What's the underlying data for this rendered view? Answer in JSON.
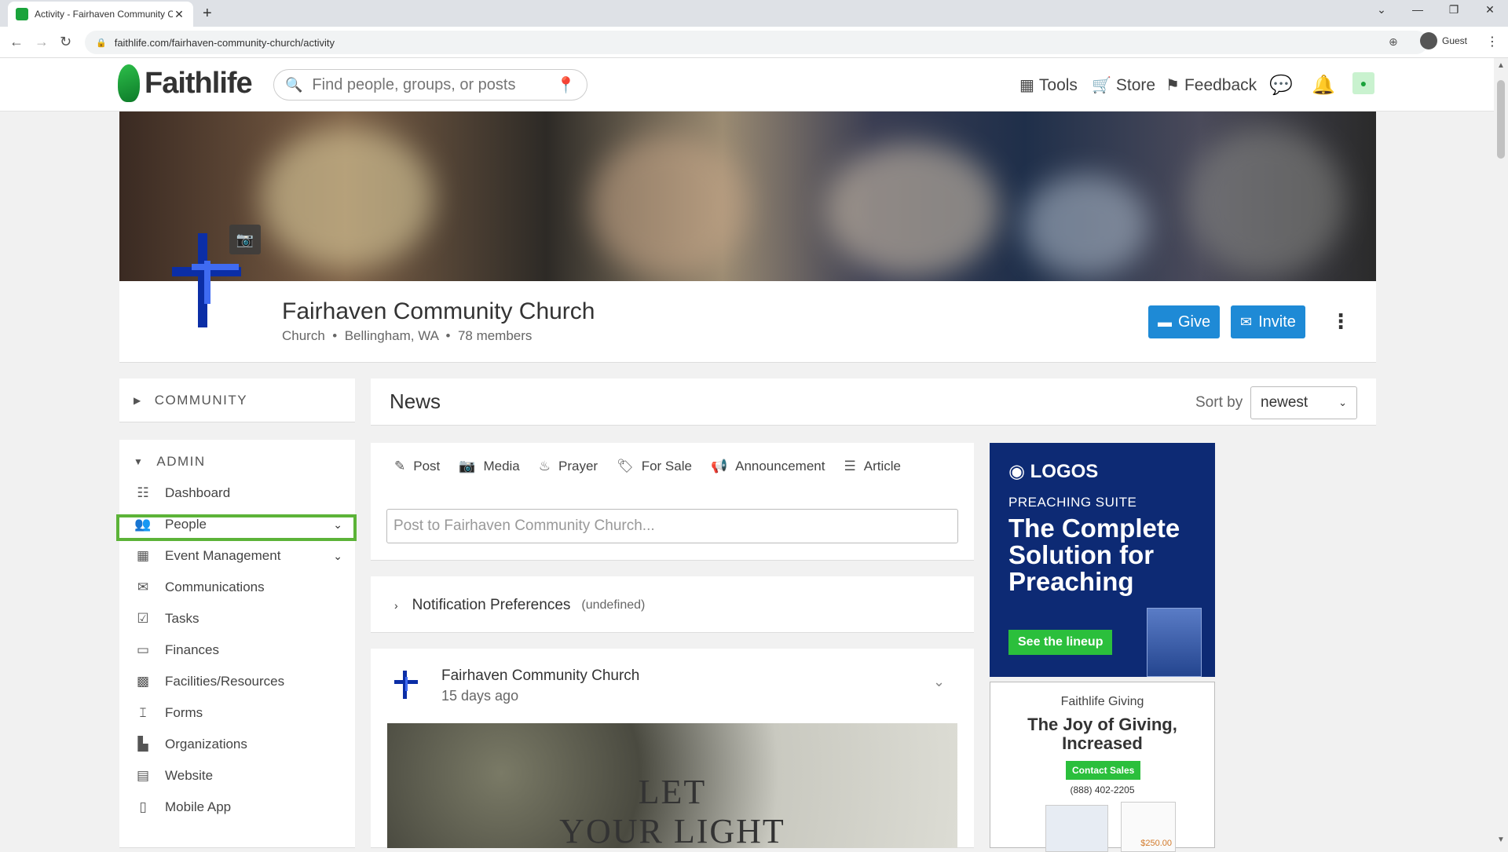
{
  "browser": {
    "tab_title": "Activity - Fairhaven Community C",
    "url": "faithlife.com/fairhaven-community-church/activity",
    "profile": "Guest"
  },
  "header": {
    "logo": "Faithlife",
    "search_placeholder": "Find people, groups, or posts",
    "nav": [
      {
        "label": "Tools",
        "icon": "grid-icon"
      },
      {
        "label": "Store",
        "icon": "cart-icon"
      },
      {
        "label": "Feedback",
        "icon": "flag-icon"
      }
    ]
  },
  "profile": {
    "name": "Fairhaven Community Church",
    "type": "Church",
    "location": "Bellingham, WA",
    "members": "78 members",
    "give_label": "Give",
    "invite_label": "Invite"
  },
  "sidebar": {
    "community_label": "COMMUNITY",
    "admin_label": "ADMIN",
    "items": [
      {
        "label": "Dashboard",
        "icon": "dashboard-icon",
        "glyph": "☷",
        "chevron": false
      },
      {
        "label": "People",
        "icon": "people-icon",
        "glyph": "👥",
        "chevron": true
      },
      {
        "label": "Event Management",
        "icon": "calendar-icon",
        "glyph": "▦",
        "chevron": true
      },
      {
        "label": "Communications",
        "icon": "envelope-icon",
        "glyph": "✉",
        "chevron": false
      },
      {
        "label": "Tasks",
        "icon": "clipboard-check-icon",
        "glyph": "☑",
        "chevron": false
      },
      {
        "label": "Finances",
        "icon": "credit-card-icon",
        "glyph": "▭",
        "chevron": false
      },
      {
        "label": "Facilities/Resources",
        "icon": "building-grid-icon",
        "glyph": "▩",
        "chevron": false
      },
      {
        "label": "Forms",
        "icon": "form-icon",
        "glyph": "𝙸",
        "chevron": false
      },
      {
        "label": "Organizations",
        "icon": "organization-icon",
        "glyph": "▙",
        "chevron": false
      },
      {
        "label": "Website",
        "icon": "website-icon",
        "glyph": "▤",
        "chevron": false
      },
      {
        "label": "Mobile App",
        "icon": "mobile-icon",
        "glyph": "▯",
        "chevron": false
      }
    ]
  },
  "feed": {
    "title": "News",
    "sort_label": "Sort by",
    "sort_value": "newest",
    "post_types": [
      {
        "label": "Post",
        "icon": "pencil-icon",
        "glyph": "✎"
      },
      {
        "label": "Media",
        "icon": "camera-icon",
        "glyph": "📷"
      },
      {
        "label": "Prayer",
        "icon": "flame-icon",
        "glyph": "♨"
      },
      {
        "label": "For Sale",
        "icon": "tag-icon",
        "glyph": "🏷"
      },
      {
        "label": "Announcement",
        "icon": "megaphone-icon",
        "glyph": "📢"
      },
      {
        "label": "Article",
        "icon": "article-icon",
        "glyph": "☰"
      }
    ],
    "composer_placeholder": "Post to Fairhaven Community Church...",
    "notification_label": "Notification Preferences",
    "notification_sub": "(undefined)",
    "post": {
      "author": "Fairhaven Community Church",
      "time": "15 days ago",
      "image_line1": "LET",
      "image_line2": "YOUR LIGHT"
    }
  },
  "ads": {
    "logos": {
      "brand": "LOGOS",
      "sub": "PREACHING SUITE",
      "headline": "The Complete Solution for Preaching",
      "cta": "See the lineup"
    },
    "giving": {
      "brand": "Faithlife Giving",
      "headline": "The Joy of Giving, Increased",
      "cta": "Contact Sales",
      "phone": "(888) 402-2205",
      "amount": "$250.00"
    }
  },
  "colors": {
    "brand_green": "#1aa33b",
    "button_blue": "#1e8ad6",
    "highlight": "#5cb338",
    "logos_navy": "#0d2a74"
  }
}
